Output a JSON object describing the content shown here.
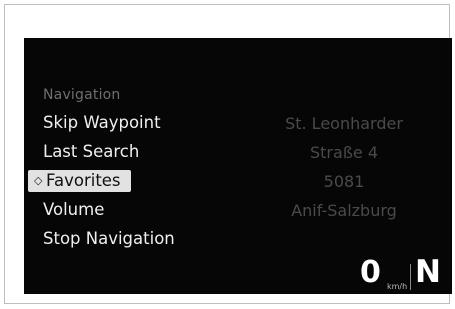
{
  "menu": {
    "title": "Navigation",
    "items": [
      {
        "label": "Skip Waypoint"
      },
      {
        "label": "Last Search"
      },
      {
        "label": "Favorites",
        "selected": true,
        "icon": "selection-diamond-icon"
      },
      {
        "label": "Volume"
      },
      {
        "label": "Stop Navigation"
      }
    ]
  },
  "destination": {
    "street": "St. Leonharder",
    "number": "Straße 4",
    "postcode": "5081",
    "city": "Anif-Salzburg"
  },
  "status": {
    "speed": "0",
    "speed_unit": "km/h",
    "gear": "N"
  },
  "colors": {
    "screen_background": "#060606",
    "menu_text": "#efefef",
    "section_title": "#6e6e6e",
    "selected_background": "#e2e2e2",
    "destination_text": "#4a4a4a"
  }
}
